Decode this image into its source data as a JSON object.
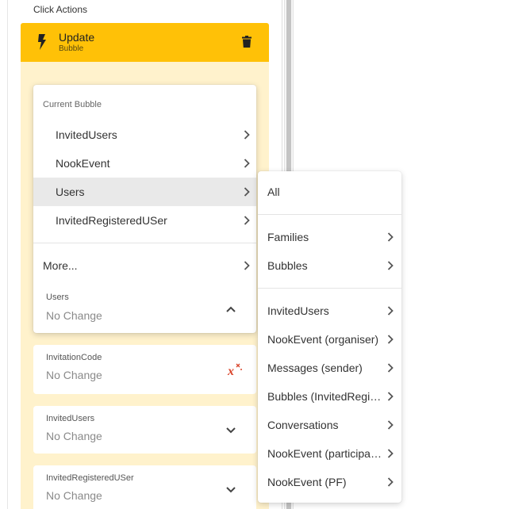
{
  "panel": {
    "section_title": "Click Actions"
  },
  "action": {
    "title": "Update",
    "subtitle": "Bubble",
    "accent_color": "#ffc107",
    "body_color": "#fff2cc",
    "icon": "bolt-icon",
    "delete_icon": "trash-icon"
  },
  "dropdown": {
    "section_label": "Current Bubble",
    "items": [
      {
        "label": "InvitedUsers",
        "has_submenu": true,
        "highlighted": false
      },
      {
        "label": "NookEvent",
        "has_submenu": true,
        "highlighted": false
      },
      {
        "label": "Users",
        "has_submenu": true,
        "highlighted": true
      },
      {
        "label": "InvitedRegisteredUSer",
        "has_submenu": true,
        "highlighted": false
      }
    ],
    "more_label": "More...",
    "field_label": "Users",
    "field_value": "No Change"
  },
  "fields": [
    {
      "label": "InvitationCode",
      "value": "No Change",
      "icon": "clear-formula-icon"
    },
    {
      "label": "InvitedUsers",
      "value": "No Change",
      "icon": "chevron-down-icon"
    },
    {
      "label": "InvitedRegisteredUSer",
      "value": "No Change",
      "icon": "chevron-down-icon"
    }
  ],
  "submenu": {
    "all_label": "All",
    "group1": [
      {
        "label": "Families",
        "has_submenu": true
      },
      {
        "label": "Bubbles",
        "has_submenu": true
      }
    ],
    "group2": [
      {
        "label": "InvitedUsers",
        "has_submenu": true
      },
      {
        "label": "NookEvent (organiser)",
        "has_submenu": true
      },
      {
        "label": "Messages (sender)",
        "has_submenu": true
      },
      {
        "label": "Bubbles (InvitedRegisteredUSer)",
        "has_submenu": true
      },
      {
        "label": "Conversations",
        "has_submenu": true
      },
      {
        "label": "NookEvent (participants)",
        "has_submenu": true
      },
      {
        "label": "NookEvent (PF)",
        "has_submenu": true
      }
    ]
  }
}
